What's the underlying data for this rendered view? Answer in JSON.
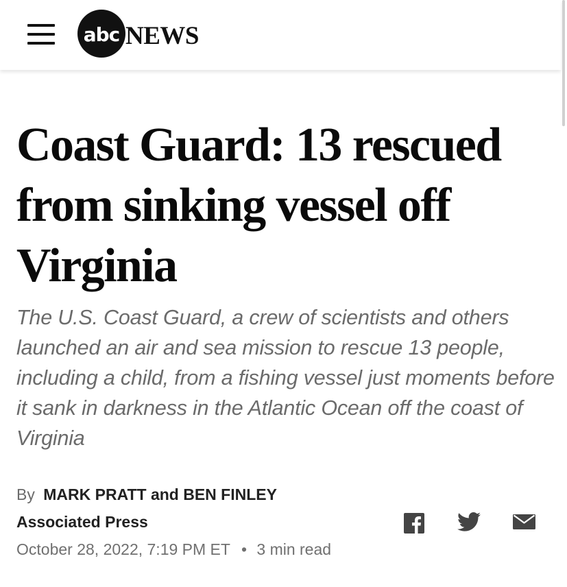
{
  "header": {
    "logo_abc": "abc",
    "logo_news": "NEWS",
    "icons": {
      "menu": "hamburger-menu-icon",
      "logo": "abc-news-logo"
    }
  },
  "article": {
    "headline": "Coast Guard: 13 rescued from sinking vessel off Virginia",
    "dek": "The U.S. Coast Guard, a crew of scientists and others launched an air and sea mission to rescue 13 people, including a child, from a fishing vessel just moments before it sank in darkness in the Atlantic Ocean off the coast of Virginia",
    "byline_prefix": "By",
    "authors": "MARK PRATT and BEN FINLEY",
    "source": "Associated Press",
    "date": "October 28, 2022, 7:19 PM ET",
    "separator": "•",
    "read_time": "3 min read"
  },
  "share": {
    "icons": [
      "facebook-icon",
      "twitter-icon",
      "email-icon"
    ]
  },
  "colors": {
    "headline": "#0a0a0a",
    "dek": "#6b6b6b",
    "meta": "#707070",
    "icons": "#444444"
  }
}
